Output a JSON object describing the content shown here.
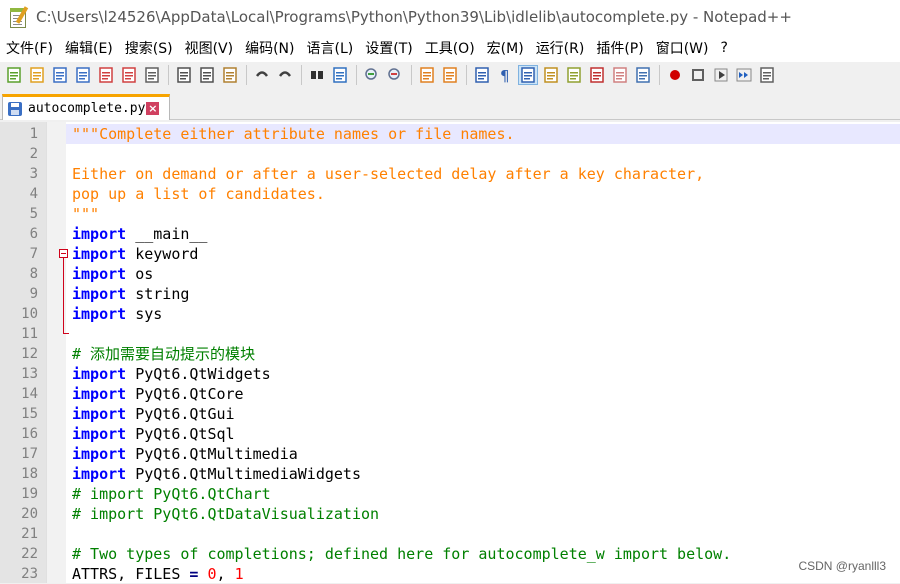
{
  "window": {
    "title": "C:\\Users\\l24526\\AppData\\Local\\Programs\\Python\\Python39\\Lib\\idlelib\\autocomplete.py - Notepad++"
  },
  "menu": [
    "文件(F)",
    "编辑(E)",
    "搜索(S)",
    "视图(V)",
    "编码(N)",
    "语言(L)",
    "设置(T)",
    "工具(O)",
    "宏(M)",
    "运行(R)",
    "插件(P)",
    "窗口(W)",
    "?"
  ],
  "toolbar": {
    "icons": [
      "new-file-icon",
      "open-file-icon",
      "save-icon",
      "save-all-icon",
      "close-icon",
      "close-all-icon",
      "print-icon",
      "cut-icon",
      "copy-icon",
      "paste-icon",
      "undo-icon",
      "redo-icon",
      "find-icon",
      "replace-icon",
      "zoom-in-icon",
      "zoom-out-icon",
      "sync-vertical-icon",
      "sync-horizontal-icon",
      "word-wrap-icon",
      "show-all-chars-icon",
      "indent-guide-icon",
      "user-lang-icon",
      "doc-map-icon",
      "function-list-icon",
      "folder-workspace-icon",
      "monitor-icon",
      "record-macro-icon",
      "stop-record-icon",
      "play-macro-icon",
      "run-macro-multiple-icon",
      "save-macro-icon"
    ],
    "active": "indent-guide-icon"
  },
  "tab": {
    "label": "autocomplete.py"
  },
  "editor": {
    "current_line": 1,
    "lines": [
      {
        "n": "1",
        "tokens": [
          {
            "t": "\"\"\"Complete either attribute names or file names.",
            "c": "str"
          }
        ]
      },
      {
        "n": "2",
        "tokens": []
      },
      {
        "n": "3",
        "tokens": [
          {
            "t": "Either on demand or after a user-selected delay after a key character,",
            "c": "str"
          }
        ]
      },
      {
        "n": "4",
        "tokens": [
          {
            "t": "pop up a list of candidates.",
            "c": "str"
          }
        ]
      },
      {
        "n": "5",
        "tokens": [
          {
            "t": "\"\"\"",
            "c": "str"
          }
        ]
      },
      {
        "n": "6",
        "tokens": [
          {
            "t": "import",
            "c": "kw"
          },
          {
            "t": " __main__",
            "c": ""
          }
        ]
      },
      {
        "n": "7",
        "tokens": [
          {
            "t": "import",
            "c": "kw"
          },
          {
            "t": " keyword",
            "c": ""
          }
        ]
      },
      {
        "n": "8",
        "tokens": [
          {
            "t": "import",
            "c": "kw"
          },
          {
            "t": " os",
            "c": ""
          }
        ]
      },
      {
        "n": "9",
        "tokens": [
          {
            "t": "import",
            "c": "kw"
          },
          {
            "t": " string",
            "c": ""
          }
        ]
      },
      {
        "n": "10",
        "tokens": [
          {
            "t": "import",
            "c": "kw"
          },
          {
            "t": " sys",
            "c": ""
          }
        ]
      },
      {
        "n": "11",
        "tokens": []
      },
      {
        "n": "12",
        "tokens": [
          {
            "t": "# 添加需要自动提示的模块",
            "c": "cmt"
          }
        ]
      },
      {
        "n": "13",
        "tokens": [
          {
            "t": "import",
            "c": "kw"
          },
          {
            "t": " PyQt6.QtWidgets",
            "c": ""
          }
        ]
      },
      {
        "n": "14",
        "tokens": [
          {
            "t": "import",
            "c": "kw"
          },
          {
            "t": " PyQt6.QtCore",
            "c": ""
          }
        ]
      },
      {
        "n": "15",
        "tokens": [
          {
            "t": "import",
            "c": "kw"
          },
          {
            "t": " PyQt6.QtGui",
            "c": ""
          }
        ]
      },
      {
        "n": "16",
        "tokens": [
          {
            "t": "import",
            "c": "kw"
          },
          {
            "t": " PyQt6.QtSql",
            "c": ""
          }
        ]
      },
      {
        "n": "17",
        "tokens": [
          {
            "t": "import",
            "c": "kw"
          },
          {
            "t": " PyQt6.QtMultimedia",
            "c": ""
          }
        ]
      },
      {
        "n": "18",
        "tokens": [
          {
            "t": "import",
            "c": "kw"
          },
          {
            "t": " PyQt6.QtMultimediaWidgets",
            "c": ""
          }
        ]
      },
      {
        "n": "19",
        "tokens": [
          {
            "t": "# import PyQt6.QtChart",
            "c": "cmt"
          }
        ]
      },
      {
        "n": "20",
        "tokens": [
          {
            "t": "# import PyQt6.QtDataVisualization",
            "c": "cmt"
          }
        ]
      },
      {
        "n": "21",
        "tokens": []
      },
      {
        "n": "22",
        "tokens": [
          {
            "t": "# Two types of completions; defined here for autocomplete_w import below.",
            "c": "cmt"
          }
        ]
      },
      {
        "n": "23",
        "tokens": [
          {
            "t": "ATTRS, FILES ",
            "c": ""
          },
          {
            "t": "=",
            "c": "op"
          },
          {
            "t": " ",
            "c": ""
          },
          {
            "t": "0",
            "c": "num"
          },
          {
            "t": ", ",
            "c": ""
          },
          {
            "t": "1",
            "c": "num"
          }
        ]
      }
    ]
  },
  "watermark": "CSDN @ryanlll3"
}
